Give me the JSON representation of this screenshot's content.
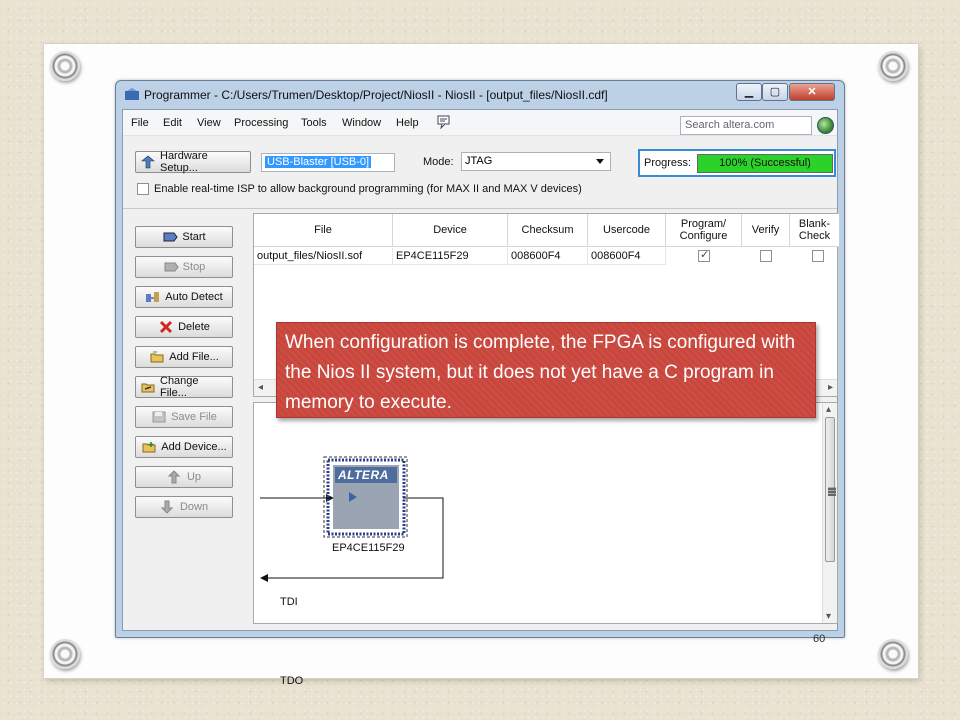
{
  "slide": {
    "page_number": "60"
  },
  "window": {
    "title": "Programmer - C:/Users/Trumen/Desktop/Project/NiosII - NiosII - [output_files/NiosII.cdf]",
    "controls": {
      "minimize": "▁",
      "maximize": "▢",
      "close": "✕"
    }
  },
  "menu": {
    "items": [
      "File",
      "Edit",
      "View",
      "Processing",
      "Tools",
      "Window",
      "Help"
    ],
    "search_placeholder": "Search altera.com"
  },
  "toolbar": {
    "hardware_setup_label": "Hardware Setup...",
    "hardware_value": "USB-Blaster [USB-0]",
    "mode_label": "Mode:",
    "mode_value": "JTAG",
    "progress_label": "Progress:",
    "progress_value": 100,
    "progress_text": "100% (Successful)",
    "isp_checkbox_label": "Enable real-time ISP to allow background programming (for MAX II and MAX V devices)",
    "isp_checked": false
  },
  "side_buttons": [
    {
      "label": "Start",
      "enabled": true,
      "icon": "start-icon"
    },
    {
      "label": "Stop",
      "enabled": false,
      "icon": "stop-icon"
    },
    {
      "label": "Auto Detect",
      "enabled": true,
      "icon": "auto-detect-icon"
    },
    {
      "label": "Delete",
      "enabled": true,
      "icon": "delete-icon"
    },
    {
      "label": "Add File...",
      "enabled": true,
      "icon": "add-file-icon"
    },
    {
      "label": "Change File...",
      "enabled": true,
      "icon": "change-file-icon"
    },
    {
      "label": "Save File",
      "enabled": false,
      "icon": "save-file-icon"
    },
    {
      "label": "Add Device...",
      "enabled": true,
      "icon": "add-device-icon"
    },
    {
      "label": "Up",
      "enabled": false,
      "icon": "up-arrow-icon"
    },
    {
      "label": "Down",
      "enabled": false,
      "icon": "down-arrow-icon"
    }
  ],
  "grid": {
    "columns": [
      "File",
      "Device",
      "Checksum",
      "Usercode",
      "Program/\nConfigure",
      "Verify",
      "Blank-\nCheck"
    ],
    "rows": [
      {
        "file": "output_files/NiosII.sof",
        "device": "EP4CE115F29",
        "checksum": "008600F4",
        "usercode": "008600F4",
        "program_configure": true,
        "verify": false,
        "blank_check": false
      }
    ]
  },
  "diagram": {
    "tdi_label": "TDI",
    "tdo_label": "TDO",
    "chip_logo": "ALTERA",
    "chip_name": "EP4CE115F29"
  },
  "callout": {
    "text": "When configuration is complete, the FPGA is configured with the Nios II system, but it does not yet have a C program in memory to execute."
  },
  "colors": {
    "progress_fill": "#2ad22a",
    "callout_background": "#c8463c",
    "selection": "#3399ff"
  }
}
